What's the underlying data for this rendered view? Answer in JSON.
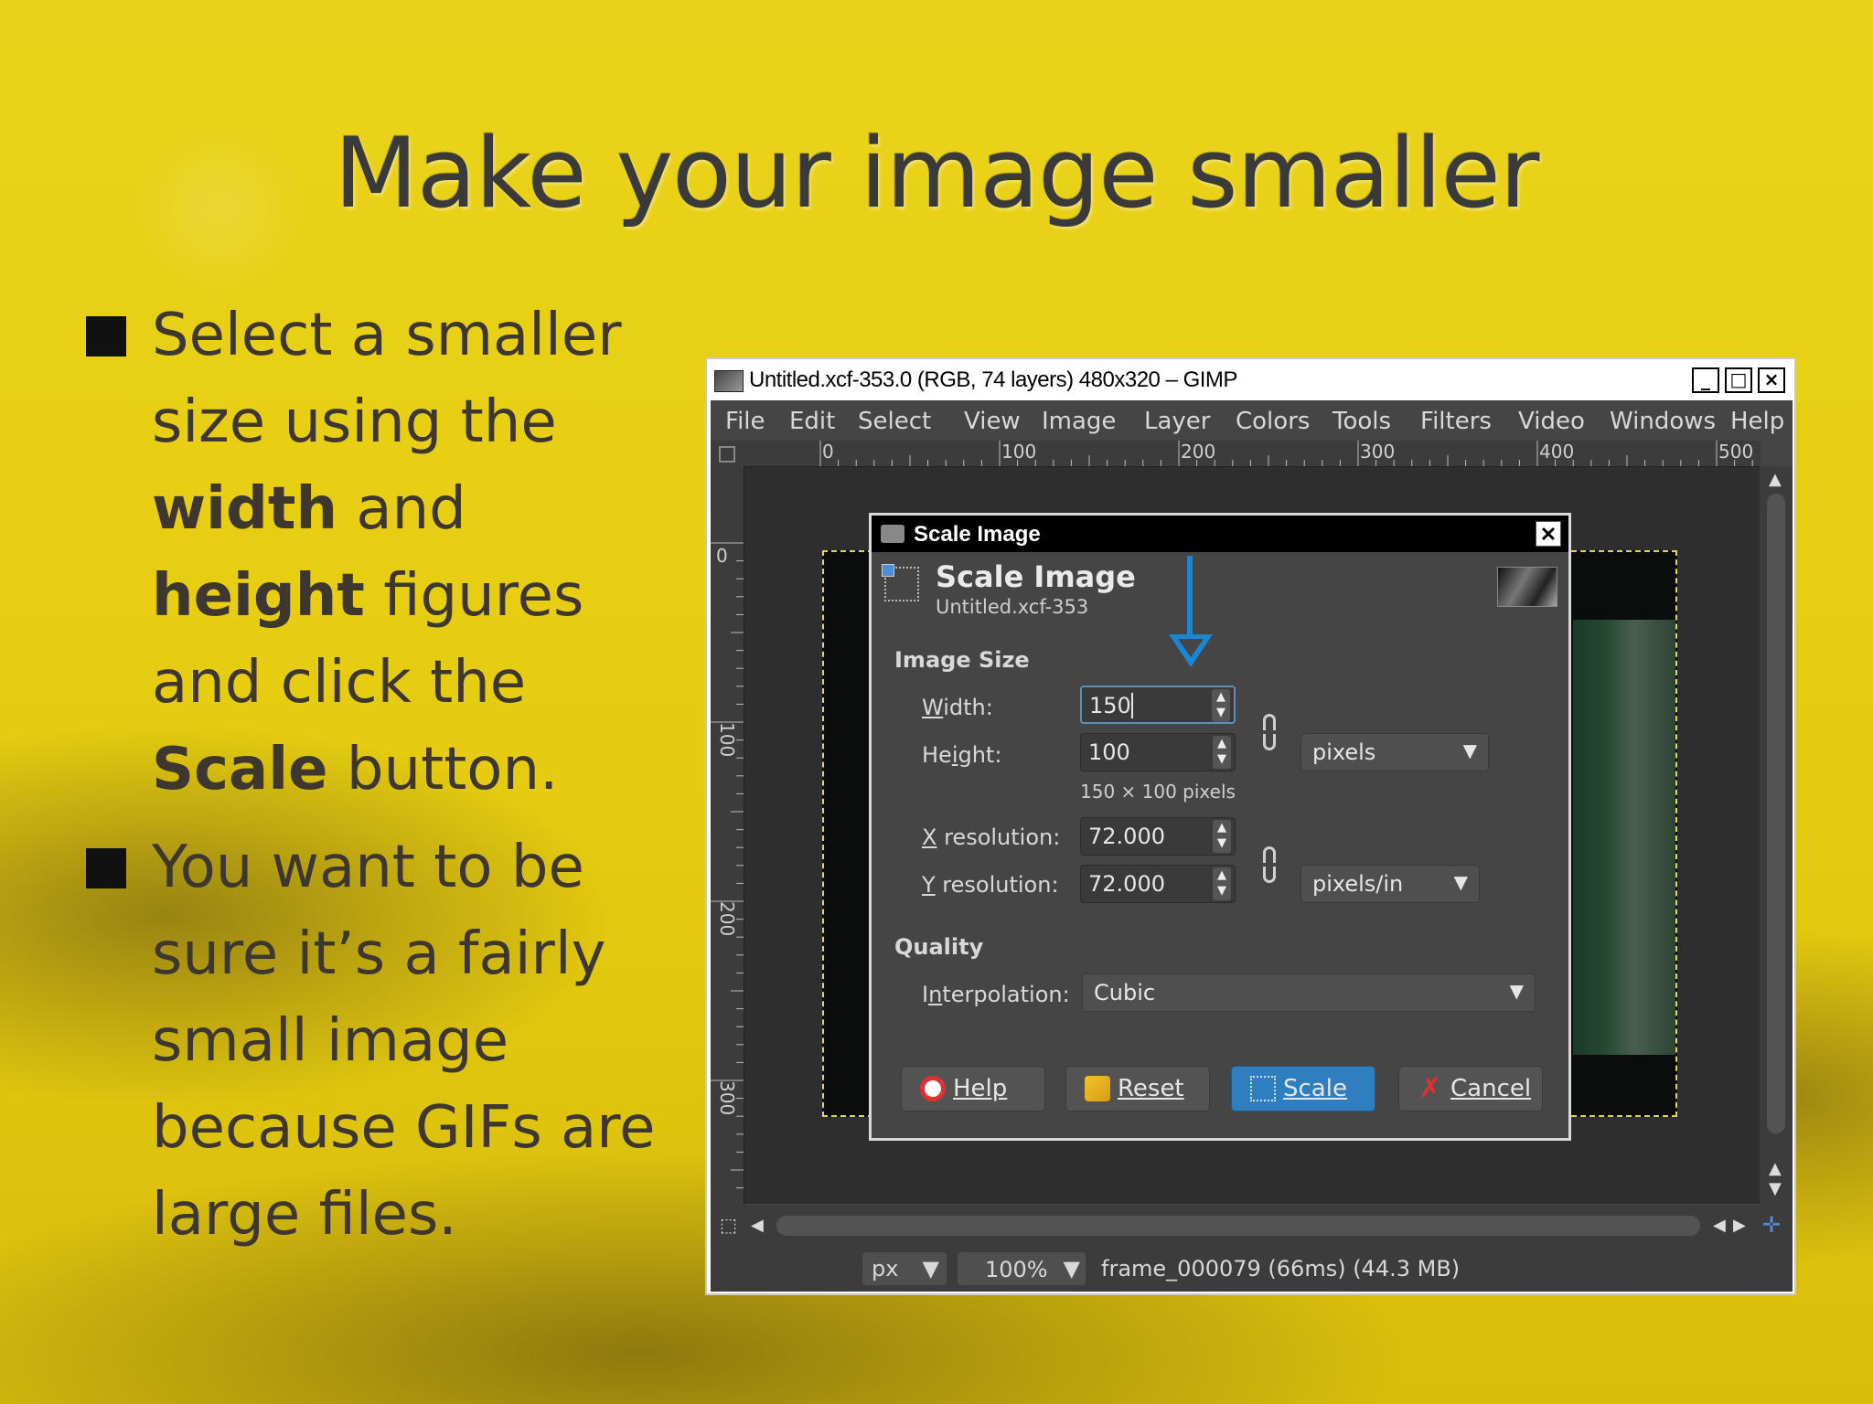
{
  "slide": {
    "title": "Make your image smaller",
    "bullets": [
      {
        "parts": [
          {
            "text": "Select a smaller size using the ",
            "bold": false
          },
          {
            "text": "width",
            "bold": true
          },
          {
            "text": " and ",
            "bold": false
          },
          {
            "text": "height",
            "bold": true
          },
          {
            "text": " figures and click the ",
            "bold": false
          },
          {
            "text": "Scale",
            "bold": true
          },
          {
            "text": " button.",
            "bold": false
          }
        ]
      },
      {
        "parts": [
          {
            "text": "You want to be sure it’s a fairly small image because GIFs are large files.",
            "bold": false
          }
        ]
      }
    ]
  },
  "gimp": {
    "window_title": "Untitled.xcf-353.0 (RGB, 74 layers) 480x320 – GIMP",
    "window_buttons": {
      "minimize": "_",
      "maximize": "□",
      "close": "×"
    },
    "menu": [
      "File",
      "Edit",
      "Select",
      "View",
      "Image",
      "Layer",
      "Colors",
      "Tools",
      "Filters",
      "Video",
      "Windows",
      "Help"
    ],
    "ruler_h_labels": [
      "0",
      "100",
      "200",
      "300",
      "400",
      "500"
    ],
    "ruler_v_labels": [
      "0",
      "100",
      "200",
      "300"
    ],
    "status": {
      "unit": "px",
      "zoom": "100%",
      "info": "frame_000079 (66ms) (44.3 MB)"
    }
  },
  "dialog": {
    "title": "Scale Image",
    "heading": "Scale Image",
    "subheading": "Untitled.xcf-353",
    "image_size_label": "Image Size",
    "width_label": "Width:",
    "width_value": "150",
    "height_label": "Height:",
    "height_value": "100",
    "size_info": "150 × 100 pixels",
    "size_unit": "pixels",
    "xres_label": "X resolution:",
    "xres_value": "72.000",
    "yres_label": "Y resolution:",
    "yres_value": "72.000",
    "res_unit": "pixels/in",
    "quality_label": "Quality",
    "interp_label": "Interpolation:",
    "interp_value": "Cubic",
    "buttons": {
      "help": "Help",
      "reset": "Reset",
      "scale": "Scale",
      "cancel": "Cancel"
    }
  },
  "colors": {
    "slide_bg": "#e6cc10",
    "title_text": "#3b3a3a",
    "gimp_dark": "#454545",
    "accent_blue": "#1a86d6",
    "scale_button": "#2f7fc0"
  }
}
